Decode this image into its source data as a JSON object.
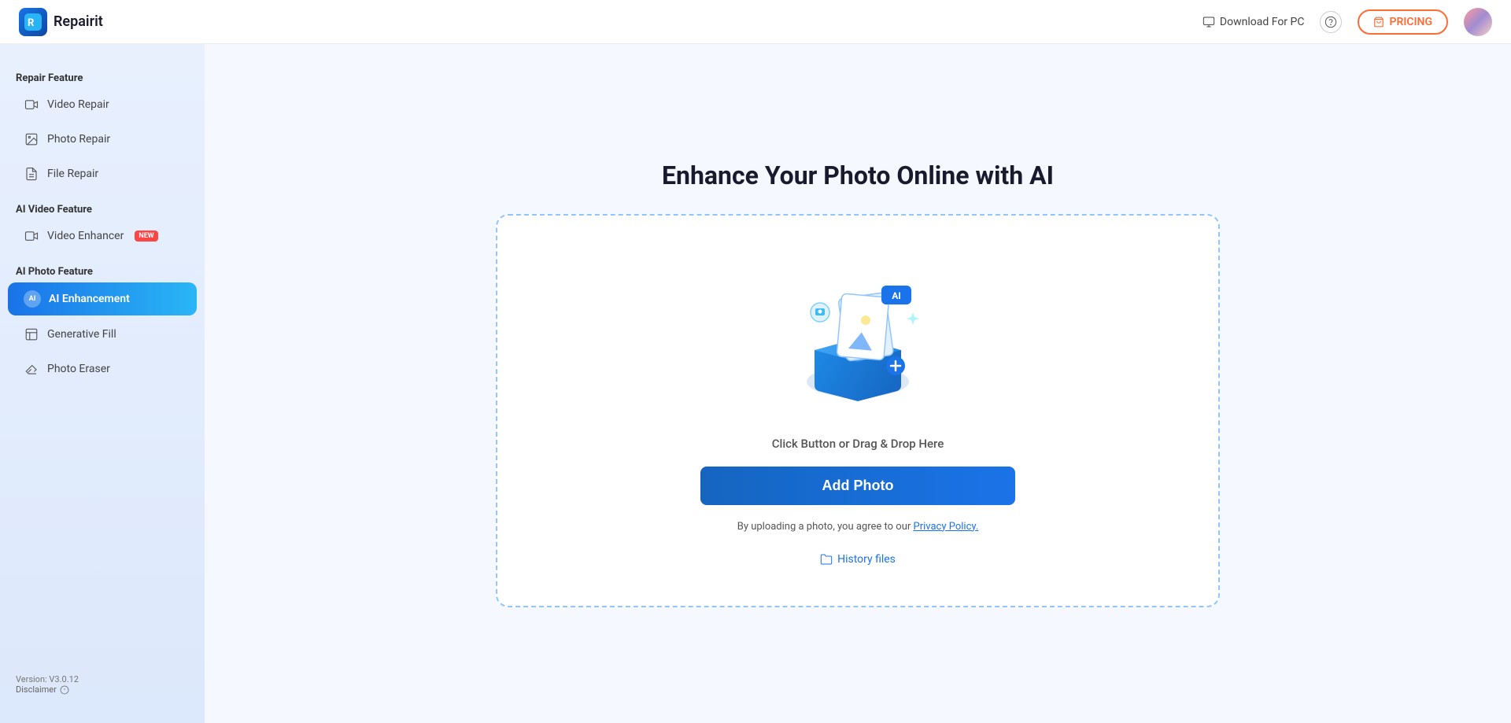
{
  "header": {
    "logo_icon": "R",
    "logo_text": "Repairit",
    "download_label": "Download For PC",
    "pricing_label": "PRICING",
    "help_icon": "?"
  },
  "sidebar": {
    "repair_feature_title": "Repair Feature",
    "ai_video_feature_title": "AI Video Feature",
    "ai_photo_feature_title": "AI Photo Feature",
    "items": [
      {
        "id": "video-repair",
        "label": "Video Repair",
        "icon": "▶",
        "active": false,
        "new": false
      },
      {
        "id": "photo-repair",
        "label": "Photo Repair",
        "icon": "🖼",
        "active": false,
        "new": false
      },
      {
        "id": "file-repair",
        "label": "File Repair",
        "icon": "📄",
        "active": false,
        "new": false
      },
      {
        "id": "video-enhancer",
        "label": "Video Enhancer",
        "icon": "🎬",
        "active": false,
        "new": true
      },
      {
        "id": "ai-enhancement",
        "label": "AI Enhancement",
        "icon": "AI",
        "active": true,
        "new": false
      },
      {
        "id": "generative-fill",
        "label": "Generative Fill",
        "icon": "◇",
        "active": false,
        "new": false
      },
      {
        "id": "photo-eraser",
        "label": "Photo Eraser",
        "icon": "◎",
        "active": false,
        "new": false
      }
    ],
    "version": "Version: V3.0.12",
    "disclaimer": "Disclaimer"
  },
  "main": {
    "title": "Enhance Your Photo Online with AI",
    "drop_hint": "Click Button or Drag & Drop Here",
    "add_photo_label": "Add Photo",
    "privacy_text": "By uploading a photo, you agree to our ",
    "privacy_link": "Privacy Policy.",
    "history_label": "History files",
    "new_badge": "NEW"
  }
}
